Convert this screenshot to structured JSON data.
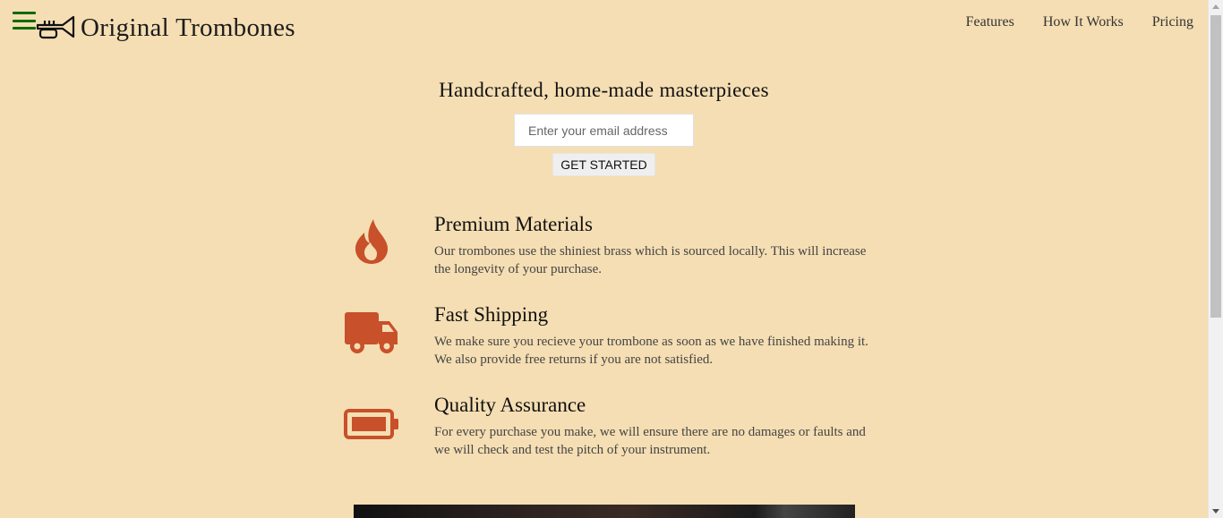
{
  "header": {
    "logo_text": "Original Trombones",
    "nav": [
      "Features",
      "How It Works",
      "Pricing"
    ]
  },
  "hero": {
    "title": "Handcrafted, home-made masterpieces",
    "email_placeholder": "Enter your email address",
    "cta_label": "GET STARTED"
  },
  "features": [
    {
      "icon": "fire-icon",
      "title": "Premium Materials",
      "text": "Our trombones use the shiniest brass which is sourced locally. This will increase the longevity of your purchase."
    },
    {
      "icon": "truck-icon",
      "title": "Fast Shipping",
      "text": "We make sure you recieve your trombone as soon as we have finished making it. We also provide free returns if you are not satisfied."
    },
    {
      "icon": "battery-full-icon",
      "title": "Quality Assurance",
      "text": "For every purchase you make, we will ensure there are no damages or faults and we will check and test the pitch of your instrument."
    }
  ],
  "colors": {
    "background": "#f5deb3",
    "icon_accent": "#c8502a",
    "hamburger": "#0a6b0a"
  }
}
